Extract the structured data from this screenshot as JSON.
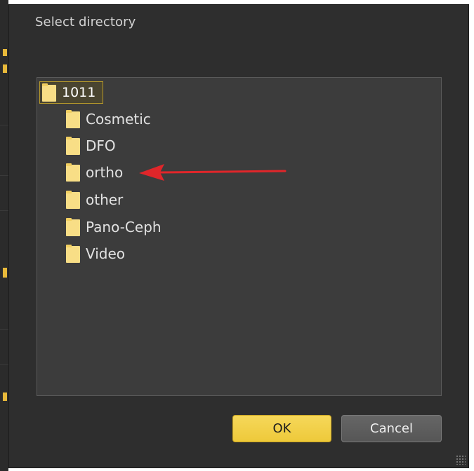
{
  "dialog": {
    "title": "Select directory"
  },
  "tree": {
    "root": {
      "label": "1011",
      "icon": "folder-icon",
      "selected": true
    },
    "children": [
      {
        "label": "Cosmetic",
        "icon": "folder-icon"
      },
      {
        "label": "DFO",
        "icon": "folder-icon"
      },
      {
        "label": "ortho",
        "icon": "folder-icon",
        "annotated": true
      },
      {
        "label": "other",
        "icon": "folder-icon"
      },
      {
        "label": "Pano-Ceph",
        "icon": "folder-icon"
      },
      {
        "label": "Video",
        "icon": "folder-icon"
      }
    ]
  },
  "buttons": {
    "ok_label": "OK",
    "cancel_label": "Cancel"
  },
  "colors": {
    "dialog_bg": "#2e2e2e",
    "panel_bg": "#3c3c3c",
    "accent": "#eec93a",
    "annotation_arrow": "#e0262a"
  }
}
